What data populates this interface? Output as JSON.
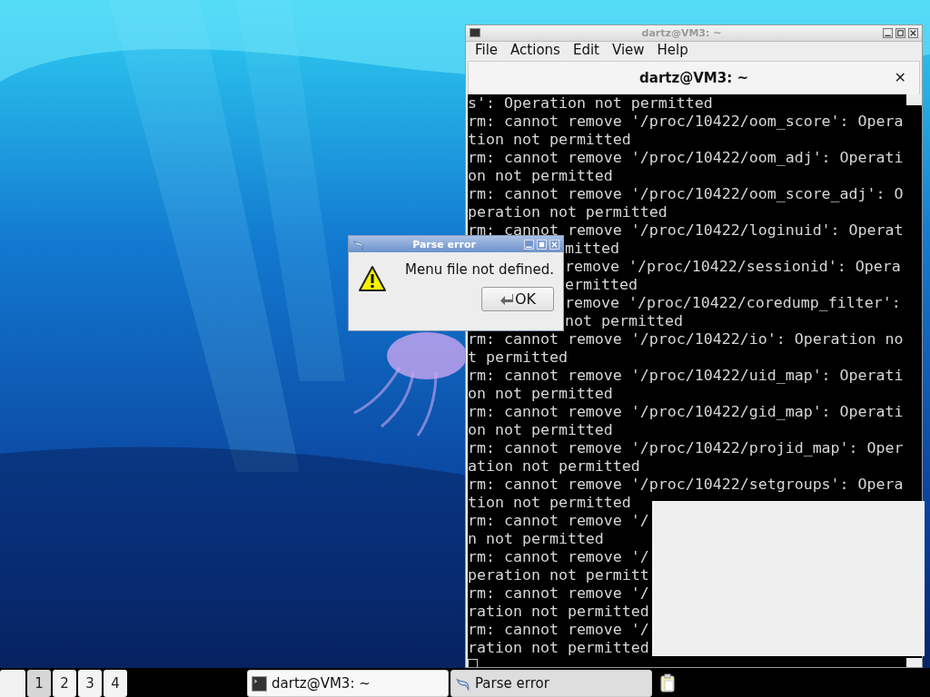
{
  "terminal": {
    "title": "dartz@VM3: ~",
    "menu": [
      "File",
      "Actions",
      "Edit",
      "View",
      "Help"
    ],
    "tab": {
      "title": "dartz@VM3: ~",
      "close": "✕"
    },
    "lines": [
      {
        "text": "s': Operation not permitted",
        "covered": false
      },
      {
        "text": "rm: cannot remove '/proc/10422/oom_score': Opera",
        "covered": false
      },
      {
        "text": "tion not permitted",
        "covered": false
      },
      {
        "text": "rm: cannot remove '/proc/10422/oom_adj': Operati",
        "covered": false
      },
      {
        "text": "on not permitted",
        "covered": false
      },
      {
        "text": "rm: cannot remove '/proc/10422/oom_score_adj': O",
        "covered": false
      },
      {
        "text": "peration not permitted",
        "covered": false
      },
      {
        "text": "rm: cannot remove '/proc/10422/loginuid': Operat",
        "covered": false
      },
      {
        "text": "mitted",
        "covered": true
      },
      {
        "text": "remove '/proc/10422/sessionid': Opera",
        "covered": true
      },
      {
        "text": "ermitted",
        "covered": true
      },
      {
        "text": "remove '/proc/10422/coredump_filter':",
        "covered": true
      },
      {
        "text": "not permitted",
        "covered": true
      },
      {
        "text": "rm: cannot remove '/proc/10422/io': Operation no",
        "covered": false
      },
      {
        "text": "t permitted",
        "covered": false
      },
      {
        "text": "rm: cannot remove '/proc/10422/uid_map': Operati",
        "covered": false
      },
      {
        "text": "on not permitted",
        "covered": false
      },
      {
        "text": "rm: cannot remove '/proc/10422/gid_map': Operati",
        "covered": false
      },
      {
        "text": "on not permitted",
        "covered": false
      },
      {
        "text": "rm: cannot remove '/proc/10422/projid_map': Oper",
        "covered": false
      },
      {
        "text": "ation not permitted",
        "covered": false
      },
      {
        "text": "rm: cannot remove '/proc/10422/setgroups': Opera",
        "covered": false
      },
      {
        "text": "tion not permitted",
        "covered": false
      },
      {
        "text": "rm: cannot remove '/",
        "covered": false
      },
      {
        "text": "n not permitted",
        "covered": false
      },
      {
        "text": "rm: cannot remove '/",
        "covered": false
      },
      {
        "text": "peration not permitt",
        "covered": false
      },
      {
        "text": "rm: cannot remove '/",
        "covered": false
      },
      {
        "text": "ration not permitted",
        "covered": false
      },
      {
        "text": "rm: cannot remove '/",
        "covered": false
      },
      {
        "text": "ration not permitted",
        "covered": false
      }
    ]
  },
  "dialog": {
    "title": "Parse error",
    "message": "Menu file not defined.",
    "button": "OK"
  },
  "taskbar": {
    "pager": [
      {
        "label": "1",
        "selected": true
      },
      {
        "label": "2",
        "selected": false
      },
      {
        "label": "3",
        "selected": false
      },
      {
        "label": "4",
        "selected": false
      }
    ],
    "tasks": [
      {
        "label": "dartz@VM3: ~",
        "kind": "terminal",
        "selected": false
      },
      {
        "label": "Parse error",
        "kind": "bird",
        "selected": true
      }
    ]
  }
}
